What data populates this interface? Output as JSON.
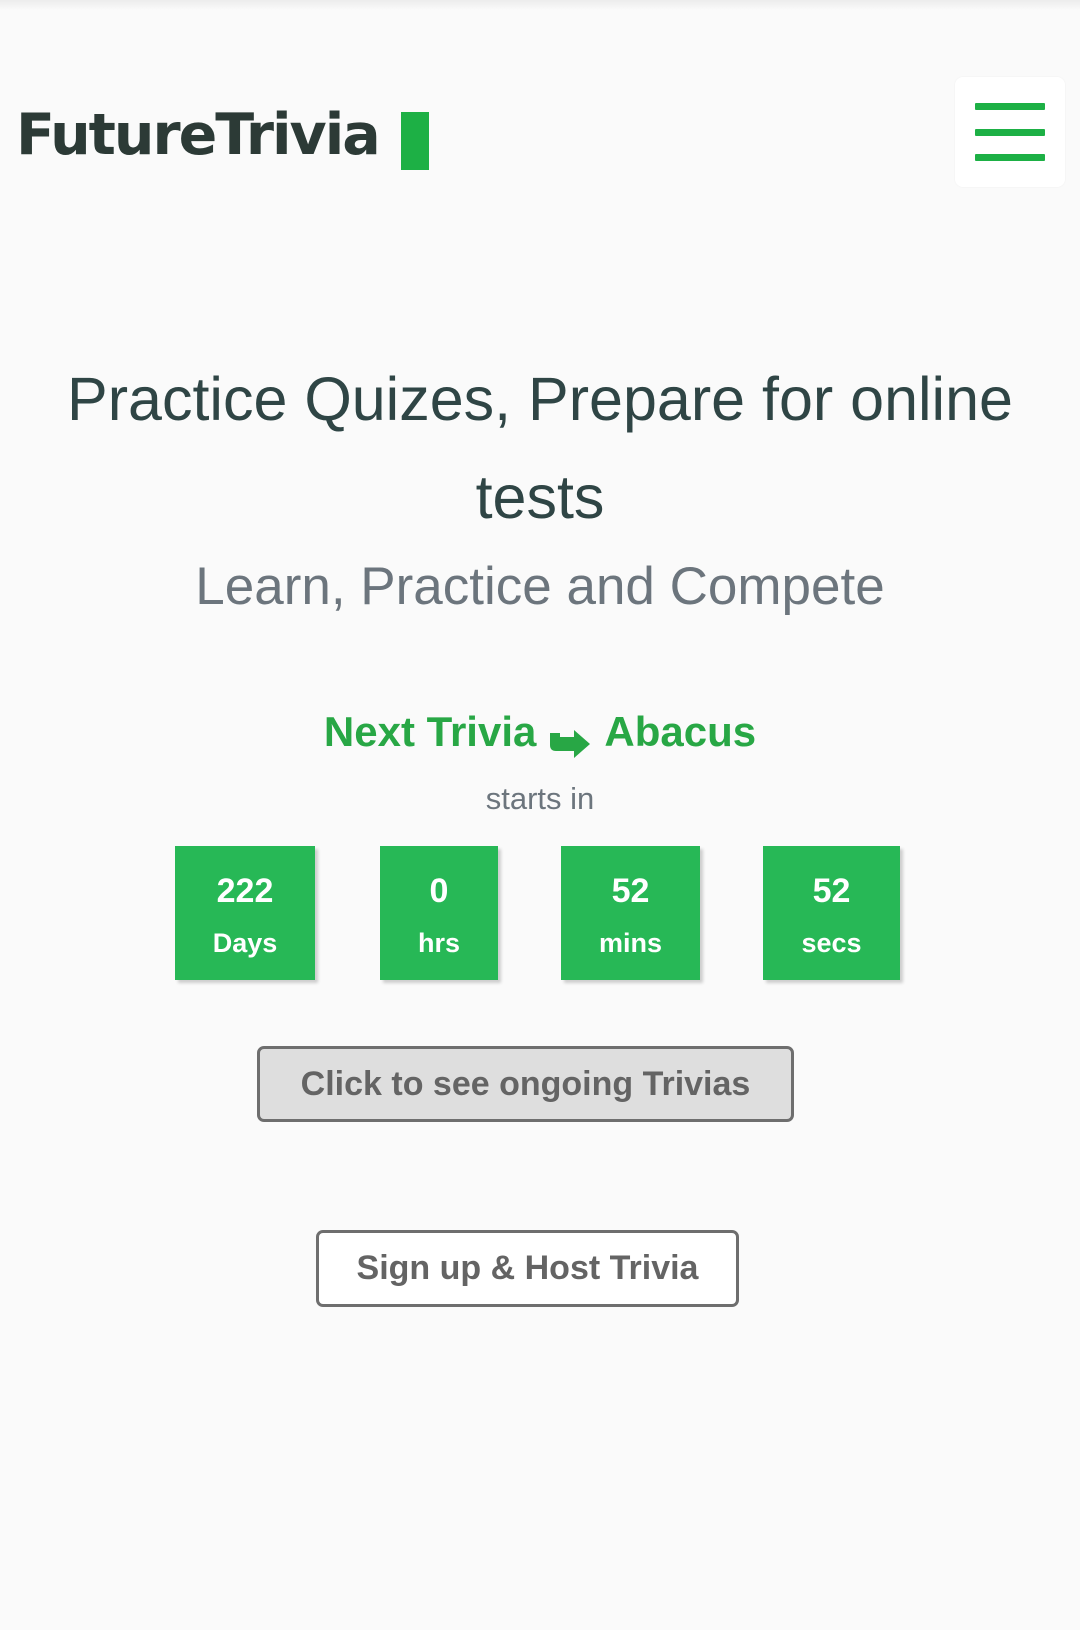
{
  "header": {
    "logo_text": "FutureTrivia",
    "menu_icon": "hamburger-menu-icon",
    "accent_color": "#1db045"
  },
  "hero": {
    "title_line1": "Practice Quizes, Prepare for online",
    "title_line2": "tests",
    "subtitle": "Learn, Practice and Compete"
  },
  "next_trivia": {
    "label": "Next Trivia",
    "arrow_icon": "share-arrow-icon",
    "name": "Abacus",
    "starts_in": "starts in"
  },
  "countdown": {
    "days": {
      "value": "222",
      "unit": "Days"
    },
    "hrs": {
      "value": "0",
      "unit": "hrs"
    },
    "mins": {
      "value": "52",
      "unit": "mins"
    },
    "secs": {
      "value": "52",
      "unit": "secs"
    },
    "box_color": "#27b856"
  },
  "buttons": {
    "ongoing": "Click to see ongoing Trivias",
    "signup": "Sign up & Host Trivia"
  }
}
